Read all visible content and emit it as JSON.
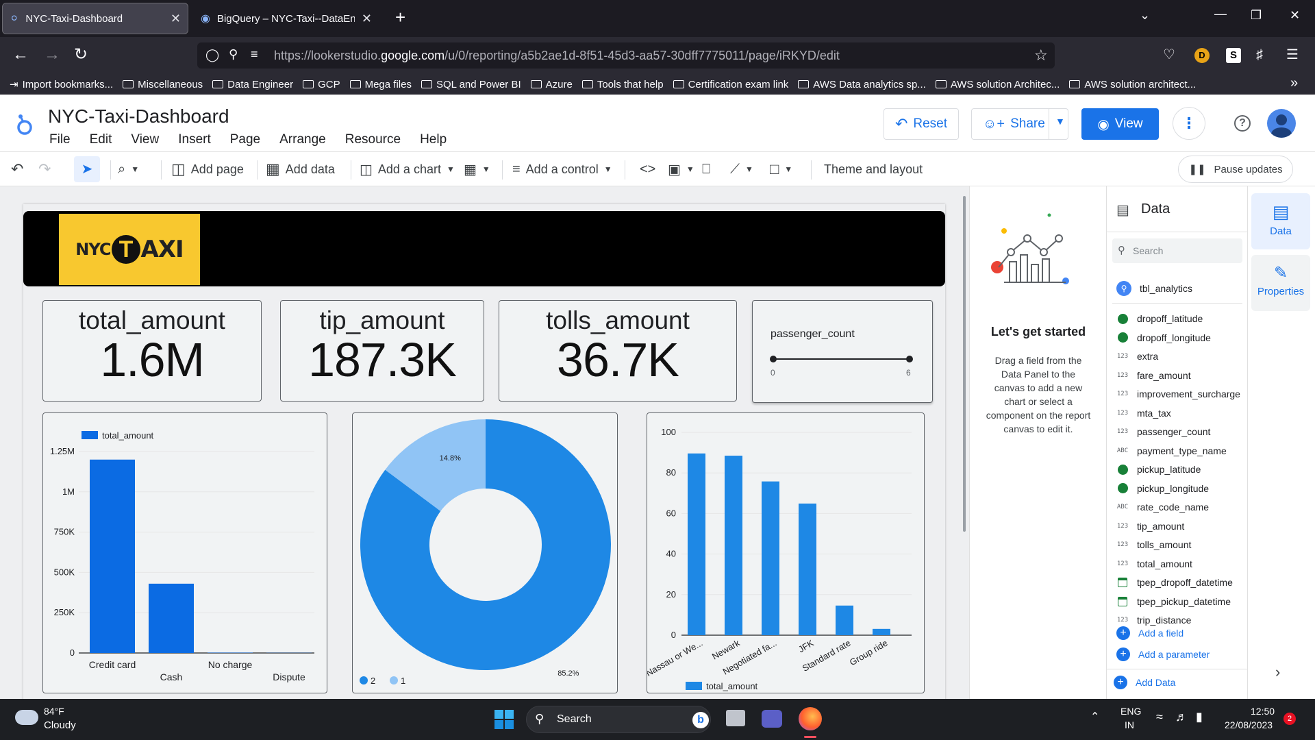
{
  "browser": {
    "tabs": [
      {
        "title": "NYC-Taxi-Dashboard",
        "active": true
      },
      {
        "title": "BigQuery – NYC-Taxi--DataEngi",
        "active": false
      }
    ],
    "url_prefix": "https://lookerstudio.",
    "url_domain": "google.com",
    "url_path": "/u/0/reporting/a5b2ae1d-8f51-45d3-aa57-30dff7775011/page/iRKYD/edit",
    "profile_letter": "D",
    "extension_letter": "S",
    "bookmarks": [
      "Import bookmarks...",
      "Miscellaneous",
      "Data Engineer",
      "GCP",
      "Mega files",
      "SQL and Power BI",
      "Azure",
      "Tools that help",
      "Certification exam link",
      "AWS Data analytics sp...",
      "AWS solution Architec...",
      "AWS solution architect..."
    ]
  },
  "app": {
    "title": "NYC-Taxi-Dashboard",
    "menus": [
      "File",
      "Edit",
      "View",
      "Insert",
      "Page",
      "Arrange",
      "Resource",
      "Help"
    ],
    "reset_label": "Reset",
    "share_label": "Share",
    "view_label": "View"
  },
  "toolbar": {
    "add_page": "Add page",
    "add_data": "Add data",
    "add_chart": "Add a chart",
    "add_control": "Add a control",
    "theme": "Theme and layout",
    "pause": "Pause updates"
  },
  "report": {
    "logo_text_nyc": "NYC",
    "logo_text_t": "T",
    "logo_text_axi": "AXI",
    "kpis": [
      {
        "label": "total_amount",
        "value": "1.6M"
      },
      {
        "label": "tip_amount",
        "value": "187.3K"
      },
      {
        "label": "tolls_amount",
        "value": "36.7K"
      }
    ],
    "slider": {
      "label": "passenger_count",
      "min_label": "0",
      "max_label": "6",
      "min": 0,
      "max": 6
    }
  },
  "chart_data": [
    {
      "type": "bar",
      "categories": [
        "Credit card",
        "Cash",
        "No charge",
        "Dispute"
      ],
      "series": [
        {
          "name": "total_amount",
          "values": [
            1200000,
            430000,
            2000,
            1000
          ]
        }
      ],
      "yticks": [
        "0",
        "250K",
        "500K",
        "750K",
        "1M",
        "1.25M"
      ],
      "ylim": [
        0,
        1250000
      ],
      "legend": "top-left",
      "color": "#0b6be3"
    },
    {
      "type": "pie",
      "donut": true,
      "slices": [
        {
          "name": "2",
          "value": 85.2,
          "label": "85.2%",
          "color": "#1e88e5"
        },
        {
          "name": "1",
          "value": 14.8,
          "label": "14.8%",
          "color": "#90c4f5"
        }
      ],
      "legend": "bottom-left"
    },
    {
      "type": "bar",
      "categories": [
        "Nassau or We...",
        "Newark",
        "Negotiated fa...",
        "JFK",
        "Standard rate",
        "Group ride"
      ],
      "series": [
        {
          "name": "total_amount",
          "values": [
            89.6,
            88.5,
            75.8,
            64.9,
            14.6,
            3.1
          ]
        }
      ],
      "yticks": [
        "0",
        "20",
        "40",
        "60",
        "80",
        "100"
      ],
      "ylim": [
        0,
        100
      ],
      "legend": "bottom",
      "color": "#1e88e5"
    }
  ],
  "getstarted": {
    "title": "Let's get started",
    "body": "Drag a field from the Data Panel to the canvas to add a new chart or select a component on the report canvas to edit it."
  },
  "datapanel": {
    "title": "Data",
    "search_placeholder": "Search",
    "source": "tbl_analytics",
    "fields": [
      {
        "name": "dropoff_latitude",
        "type": "geo"
      },
      {
        "name": "dropoff_longitude",
        "type": "geo"
      },
      {
        "name": "extra",
        "type": "num"
      },
      {
        "name": "fare_amount",
        "type": "num"
      },
      {
        "name": "improvement_surcharge",
        "type": "num"
      },
      {
        "name": "mta_tax",
        "type": "num"
      },
      {
        "name": "passenger_count",
        "type": "num"
      },
      {
        "name": "payment_type_name",
        "type": "text"
      },
      {
        "name": "pickup_latitude",
        "type": "geo"
      },
      {
        "name": "pickup_longitude",
        "type": "geo"
      },
      {
        "name": "rate_code_name",
        "type": "text"
      },
      {
        "name": "tip_amount",
        "type": "num"
      },
      {
        "name": "tolls_amount",
        "type": "num"
      },
      {
        "name": "total_amount",
        "type": "num"
      },
      {
        "name": "tpep_dropoff_datetime",
        "type": "date"
      },
      {
        "name": "tpep_pickup_datetime",
        "type": "date"
      },
      {
        "name": "trip_distance",
        "type": "num"
      }
    ],
    "add_field": "Add a field",
    "add_parameter": "Add a parameter",
    "add_data": "Add Data",
    "num_icon": "123",
    "text_icon": "ABC"
  },
  "sidetabs": {
    "data": "Data",
    "properties": "Properties"
  },
  "taskbar": {
    "temp": "84°F",
    "weather": "Cloudy",
    "search": "Search",
    "lang1": "ENG",
    "lang2": "IN",
    "time": "12:50",
    "date": "22/08/2023",
    "notifications": "2"
  }
}
